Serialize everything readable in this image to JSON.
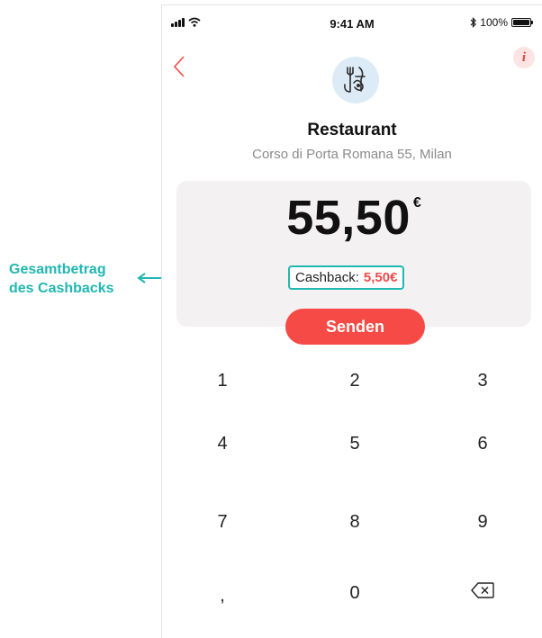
{
  "status_bar": {
    "time": "9:41 AM",
    "battery": "100%"
  },
  "merchant": {
    "name": "Restaurant",
    "address": "Corso di Porta Romana 55, Milan"
  },
  "payment": {
    "amount": "55,50",
    "currency": "€",
    "cashback_label": "Cashback:",
    "cashback_value": "5,50€"
  },
  "actions": {
    "send_label": "Senden",
    "info_label": "i"
  },
  "keypad": {
    "keys": [
      "1",
      "2",
      "3",
      "4",
      "5",
      "6",
      "7",
      "8",
      "9",
      ",",
      "0"
    ]
  },
  "annotation": {
    "line1": "Gesamtbetrag",
    "line2": "des Cashbacks"
  },
  "colors": {
    "accent_red": "#f54a45",
    "annotation_teal": "#21b7b1",
    "card_background": "#f3f1f2",
    "logo_background": "#dcebf6"
  },
  "icons": {
    "back": "chevron-left-icon",
    "info": "info-icon",
    "logo": "restaurant-logo",
    "delete": "backspace-icon",
    "signal": "signal-icon",
    "wifi": "wifi-icon",
    "bluetooth": "bluetooth-icon",
    "battery": "battery-icon"
  }
}
